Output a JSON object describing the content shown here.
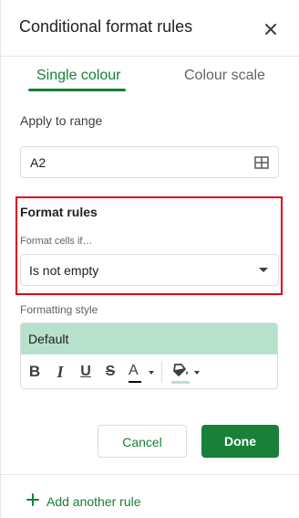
{
  "panel": {
    "title": "Conditional format rules",
    "close_icon": "close-icon"
  },
  "tabs": [
    {
      "label": "Single colour",
      "active": true
    },
    {
      "label": "Colour scale",
      "active": false
    }
  ],
  "apply_to_range": {
    "label": "Apply to range",
    "value": "A2",
    "icon": "grid-select-icon"
  },
  "format_rules": {
    "title": "Format rules",
    "condition_label": "Format cells if…",
    "condition_value": "Is not empty"
  },
  "formatting_style": {
    "label": "Formatting style",
    "preview_text": "Default",
    "preview_color": "#b7e1cd",
    "toolbar": {
      "bold": "B",
      "italic": "I",
      "underline": "U",
      "strikethrough": "S",
      "text_color": "A"
    }
  },
  "actions": {
    "cancel": "Cancel",
    "done": "Done"
  },
  "footer": {
    "add_rule": "Add another rule"
  },
  "colors": {
    "accent": "#188038",
    "highlight_border": "#e0001c",
    "fill_color": "#b7e1cd"
  }
}
